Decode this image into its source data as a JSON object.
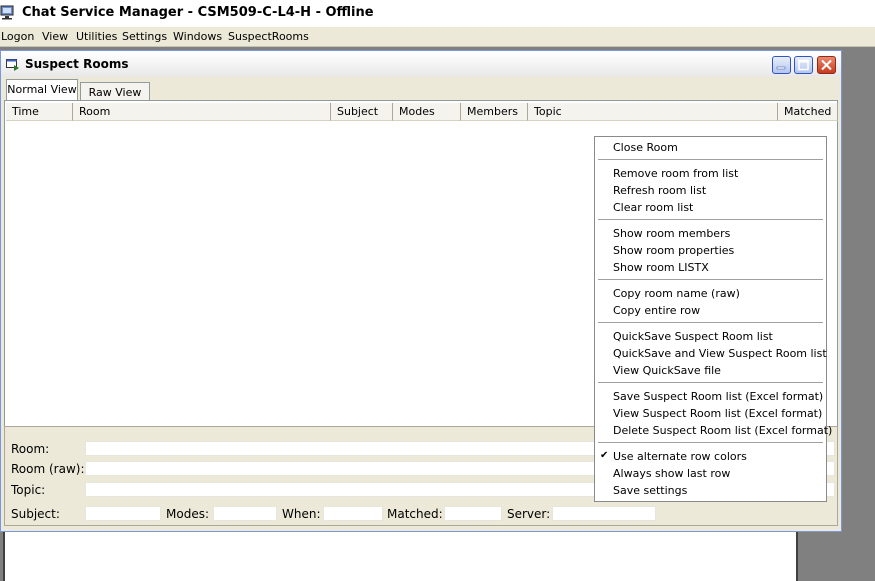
{
  "app": {
    "title": "Chat Service Manager - CSM509-C-L4-H - Offline"
  },
  "menubar": [
    "Logon",
    "View",
    "Utilities",
    "Settings",
    "Windows",
    "SuspectRooms"
  ],
  "child_window": {
    "title": "Suspect Rooms",
    "tabs": [
      "Normal View",
      "Raw View"
    ],
    "columns": [
      "Time",
      "Room",
      "Subject",
      "Modes",
      "Members",
      "Topic",
      "Matched"
    ],
    "details": {
      "room_label": "Room:",
      "room_raw_label": "Room (raw):",
      "topic_label": "Topic:",
      "subject_label": "Subject:",
      "modes_label": "Modes:",
      "when_label": "When:",
      "matched_label": "Matched:",
      "server_label": "Server:"
    }
  },
  "context_menu": {
    "close_room": "Close Room",
    "remove_room": "Remove room from list",
    "refresh_list": "Refresh room list",
    "clear_list": "Clear room list",
    "show_members": "Show room members",
    "show_properties": "Show room properties",
    "show_listx": "Show room LISTX",
    "copy_name": "Copy room name (raw)",
    "copy_row": "Copy entire row",
    "quicksave": "QuickSave Suspect Room list",
    "quicksave_view": "QuickSave and View Suspect Room list",
    "view_quicksave": "View QuickSave file",
    "save_excel": "Save Suspect Room list (Excel format)",
    "view_excel": "View Suspect Room list (Excel format)",
    "delete_excel": "Delete Suspect Room list (Excel format)",
    "alt_row_colors": "Use alternate row colors",
    "always_last_row": "Always show last row",
    "save_settings": "Save settings",
    "check_mark": "✔"
  }
}
